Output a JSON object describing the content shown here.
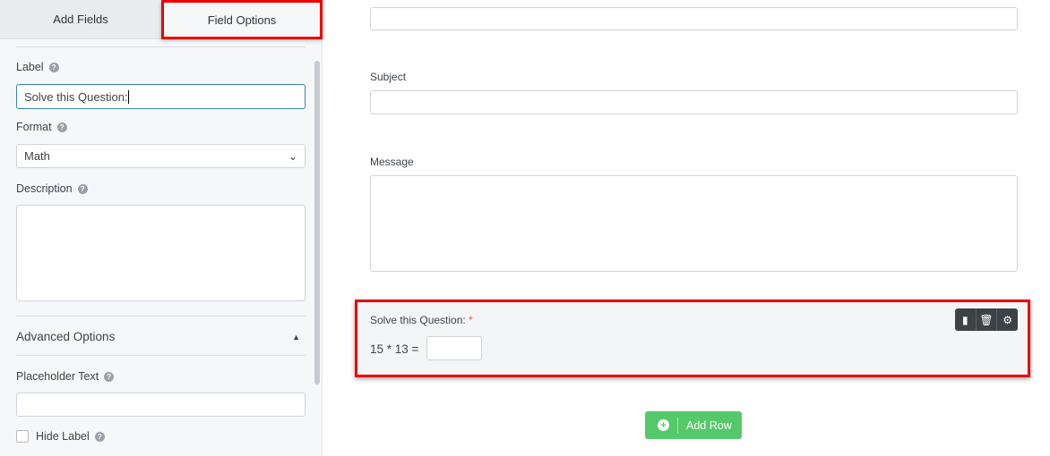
{
  "tabs": {
    "add_fields": "Add Fields",
    "field_options": "Field Options"
  },
  "options": {
    "label_title": "Label",
    "label_value": "Solve this Question:",
    "format_title": "Format",
    "format_value": "Math",
    "description_title": "Description",
    "description_value": "",
    "advanced_title": "Advanced Options",
    "placeholder_title": "Placeholder Text",
    "placeholder_value": "",
    "hide_label": "Hide Label"
  },
  "form": {
    "subject_label": "Subject",
    "message_label": "Message",
    "math_label": "Solve this Question:",
    "required_mark": "*",
    "equation": "15 * 13 =",
    "add_row": "Add Row"
  },
  "colors": {
    "highlight": "#ee0000",
    "add_row": "#55c96a",
    "toolbar": "#3d4247"
  }
}
